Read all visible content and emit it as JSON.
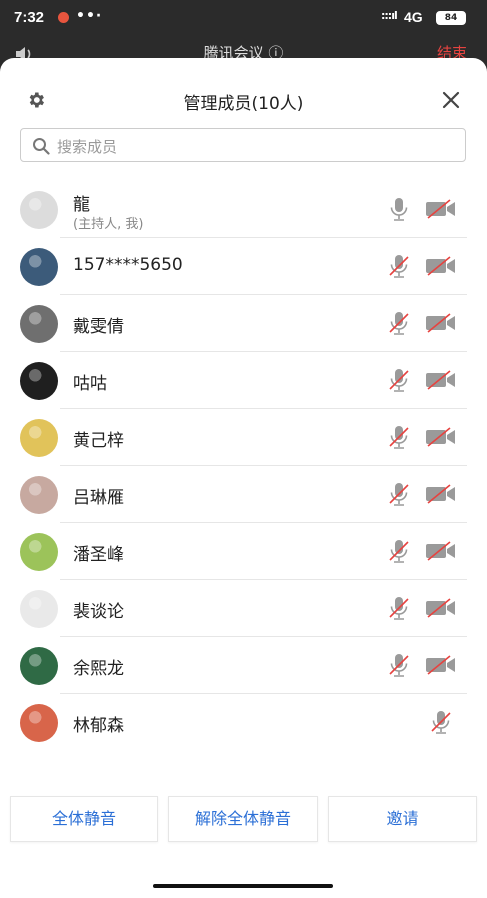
{
  "status_bar": {
    "time": "7:32",
    "dots": "••·",
    "signal": ":::ıl",
    "network": "4G",
    "battery": "84"
  },
  "background_header": {
    "title": "腾讯会议 ⓘ",
    "end_label": "结束"
  },
  "sheet": {
    "title": "管理成员(10人)",
    "search_placeholder": "搜索成员"
  },
  "members": [
    {
      "name": "龍",
      "sub": "(主持人, 我)",
      "mic": "on",
      "camera": "off",
      "avatar_color": "#dcdcdc"
    },
    {
      "name": "157****5650",
      "mic": "muted",
      "camera": "off",
      "avatar_color": "#3c5b7a"
    },
    {
      "name": "戴雯倩",
      "mic": "muted",
      "camera": "off",
      "avatar_color": "#6f6f6f"
    },
    {
      "name": "咕咕",
      "mic": "muted",
      "camera": "off",
      "avatar_color": "#1f1f1f"
    },
    {
      "name": "黄己梓",
      "mic": "muted",
      "camera": "off",
      "avatar_color": "#e1c35a"
    },
    {
      "name": "吕琳雁",
      "mic": "muted",
      "camera": "off",
      "avatar_color": "#c7a9a0"
    },
    {
      "name": "潘圣峰",
      "mic": "muted",
      "camera": "off",
      "avatar_color": "#9cc35a"
    },
    {
      "name": "裴谈论",
      "mic": "muted",
      "camera": "off",
      "avatar_color": "#e9e9e9"
    },
    {
      "name": "余熙龙",
      "mic": "muted",
      "camera": "off",
      "avatar_color": "#2f6a45"
    },
    {
      "name": "林郁森",
      "mic": "muted",
      "avatar_color": "#d8654a"
    }
  ],
  "actions": {
    "mute_all": "全体静音",
    "unmute_all": "解除全体静音",
    "invite": "邀请"
  },
  "colors": {
    "accent": "#2b6fd6",
    "muted_red": "#e64340",
    "icon_gray": "#9a9a9a"
  }
}
